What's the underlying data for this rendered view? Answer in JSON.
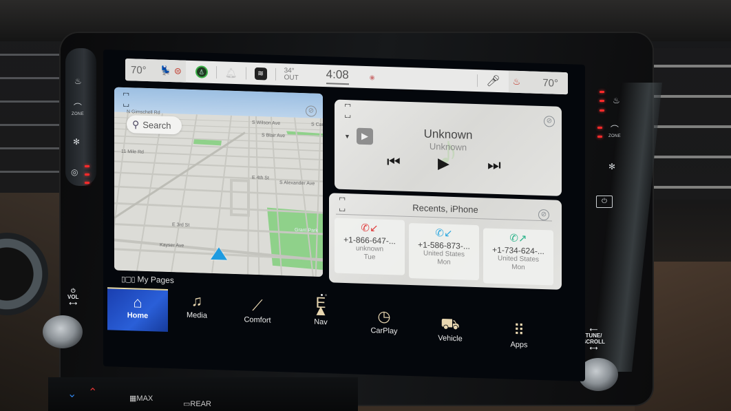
{
  "status_bar": {
    "driver_temp": "70°",
    "driver_seat_icon": "seat-icon",
    "driver_heated_wheel_icon": "heated-steering-wheel-icon",
    "profile_icon": "driver-profile-icon",
    "notifications_icon": "bell-icon",
    "wifi_icon": "wifi-icon",
    "outside_temp": "34°",
    "outside_label": "OUT",
    "clock": "4:08",
    "media_indicator_icon": "play-indicator-icon",
    "mic_icon": "microphone-icon",
    "passenger_seat_icon": "heated-seat-icon",
    "passenger_temp": "70°"
  },
  "map_widget": {
    "search_label": "Search",
    "street_labels": [
      "N Gimschell Rd",
      "S Wilson Ave",
      "S Cam",
      "S Blair Ave",
      "11 Mile Rd",
      "E 4th St",
      "S Alexander Ave",
      "E 3rd St",
      "Kayser Ave",
      "Grant Park"
    ],
    "colors": {
      "park": "#8fd18a",
      "road": "#c8c8c2",
      "land": "#dcdcd7",
      "position": "#1e9be0"
    }
  },
  "media_widget": {
    "title": "Unknown",
    "artist": "Unknown",
    "source_icon": "carplay-icon",
    "controls": {
      "previous": "⏮",
      "play": "▶",
      "next": "⏭"
    }
  },
  "recents_widget": {
    "header": "Recents, iPhone",
    "calls": [
      {
        "number": "+1-866-647-...",
        "location": "unknown",
        "day": "Tue",
        "type": "missed",
        "color": "#e03a3a"
      },
      {
        "number": "+1-586-873-...",
        "location": "United States",
        "day": "Mon",
        "type": "incoming",
        "color": "#2ea8e0"
      },
      {
        "number": "+1-734-624-...",
        "location": "United States",
        "day": "Mon",
        "type": "outgoing",
        "color": "#2bb38a"
      }
    ]
  },
  "dock": {
    "my_pages_label": "My Pages",
    "page_count": 2,
    "current_page": 1,
    "items": [
      {
        "label": "Home",
        "icon": "home-icon",
        "active": true
      },
      {
        "label": "Media",
        "icon": "music-note-icon"
      },
      {
        "label": "Comfort",
        "icon": "seat-comfort-icon"
      },
      {
        "label": "Nav",
        "icon": "compass-icon",
        "heading": "E"
      },
      {
        "label": "CarPlay",
        "icon": "carplay-icon"
      },
      {
        "label": "Vehicle",
        "icon": "vehicle-icon"
      },
      {
        "label": "Apps",
        "icon": "apps-grid-icon"
      }
    ]
  },
  "hardware": {
    "left_controls": [
      "heated-seat",
      "seat-zone",
      "ventilated-seat",
      "heated-steering-wheel"
    ],
    "left_zone_label": "ZONE",
    "vol_label": "VOL",
    "right_controls": [
      "heated-seat",
      "seat-zone",
      "ventilated-seat",
      "display-off"
    ],
    "right_zone_label": "ZONE",
    "tune_label": "TUNE/\nSCROLL",
    "hvac_buttons": [
      "MAX",
      "REAR"
    ]
  }
}
